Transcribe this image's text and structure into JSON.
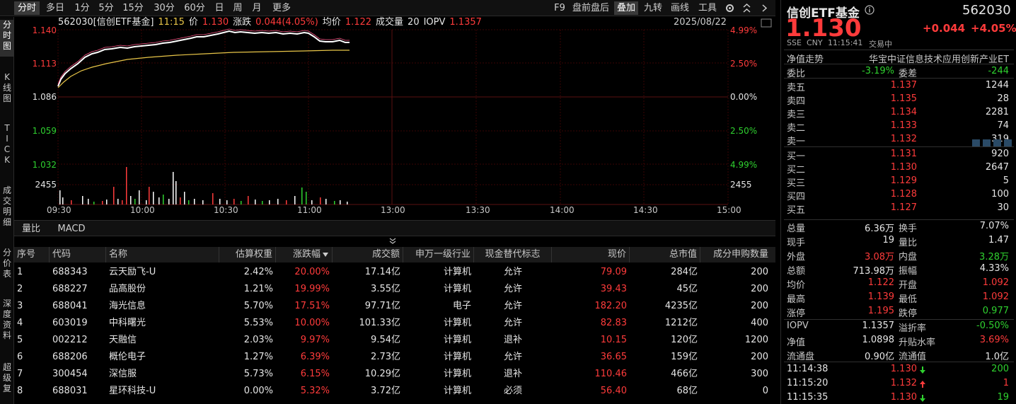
{
  "toolbar": {
    "periods": [
      "分时",
      "多日",
      "1分",
      "5分",
      "15分",
      "30分",
      "60分",
      "日",
      "周",
      "月",
      "更多"
    ],
    "tools": [
      "F9",
      "盘前盘后",
      "叠加",
      "九转",
      "画线",
      "工具"
    ]
  },
  "left_tabs": [
    "分\n时\n图",
    "K\n线\n图",
    "T\nI\nC\nK",
    "成\n交\n明\n细",
    "分\n价\n表",
    "深\n度\n资\n料",
    "超\n级\n复"
  ],
  "chart": {
    "code_name": "562030[信创ETF基金]",
    "time": "11:15",
    "price_label": "价",
    "price": "1.130",
    "change_label": "涨跌",
    "change": "0.044(4.05%)",
    "avg_label": "均价",
    "avg": "1.122",
    "vol_label": "成交量",
    "vol": "20",
    "iopv_label": "IOPV",
    "iopv": "1.1357",
    "date": "2025/08/22",
    "left_labels": [
      "1.140",
      "1.113",
      "1.086",
      "1.059",
      "1.032"
    ],
    "right_labels": [
      "4.99%",
      "2.50%",
      "0.00%",
      "2.50%",
      "4.99%"
    ],
    "vol_label_value": "2455",
    "time_labels": [
      "09:30",
      "10:00",
      "10:30",
      "11:00",
      "13:00",
      "13:30",
      "14:00",
      "14:30",
      "15:00"
    ]
  },
  "indicator_tabs": [
    "量比",
    "MACD"
  ],
  "table": {
    "headers": [
      "序号",
      "代码",
      "名称",
      "估算权重",
      "涨跌幅",
      "成交额",
      "申万一级行业",
      "现金替代标志",
      "现价",
      "总市值",
      "成分申购数量"
    ],
    "rows": [
      [
        "1",
        "688343",
        "云天励飞-U",
        "2.42%",
        "20.00%",
        "17.14亿",
        "计算机",
        "允许",
        "79.09",
        "284亿",
        "200"
      ],
      [
        "2",
        "688227",
        "品高股份",
        "1.21%",
        "19.99%",
        "3.55亿",
        "计算机",
        "允许",
        "39.43",
        "45亿",
        "200"
      ],
      [
        "3",
        "688041",
        "海光信息",
        "5.70%",
        "17.51%",
        "97.71亿",
        "电子",
        "允许",
        "182.20",
        "4235亿",
        "200"
      ],
      [
        "4",
        "603019",
        "中科曙光",
        "5.53%",
        "10.00%",
        "101.33亿",
        "计算机",
        "允许",
        "82.83",
        "1212亿",
        "400"
      ],
      [
        "5",
        "002212",
        "天融信",
        "2.03%",
        "9.97%",
        "9.54亿",
        "计算机",
        "退补",
        "10.15",
        "120亿",
        "1200"
      ],
      [
        "6",
        "688206",
        "概伦电子",
        "1.27%",
        "6.39%",
        "2.73亿",
        "计算机",
        "允许",
        "36.65",
        "159亿",
        "200"
      ],
      [
        "7",
        "300454",
        "深信服",
        "5.73%",
        "6.15%",
        "10.29亿",
        "计算机",
        "退补",
        "110.46",
        "466亿",
        "300"
      ],
      [
        "8",
        "688031",
        "星环科技-U",
        "0.00%",
        "5.32%",
        "3.72亿",
        "计算机",
        "必须",
        "56.40",
        "68亿",
        "0"
      ]
    ]
  },
  "quote": {
    "name": "信创ETF基金",
    "code": "562030",
    "price": "1.130",
    "change": "+0.044",
    "change_pct": "+4.05%",
    "exchange": "SSE",
    "currency": "CNY",
    "time": "11:15:41",
    "status": "交易中",
    "nav_trend": "净值走势",
    "tracked_index": "华宝中证信息技术应用创新产业ET",
    "weibi_label": "委比",
    "weibi": "-3.19%",
    "weicha_label": "委差",
    "weicha": "-244",
    "asks": [
      {
        "label": "卖五",
        "price": "1.137",
        "vol": "1244"
      },
      {
        "label": "卖四",
        "price": "1.135",
        "vol": "28"
      },
      {
        "label": "卖三",
        "price": "1.134",
        "vol": "2281"
      },
      {
        "label": "卖二",
        "price": "1.133",
        "vol": "74"
      },
      {
        "label": "卖一",
        "price": "1.132",
        "vol": "319"
      }
    ],
    "bids": [
      {
        "label": "买一",
        "price": "1.131",
        "vol": "920"
      },
      {
        "label": "买二",
        "price": "1.130",
        "vol": "2647"
      },
      {
        "label": "买三",
        "price": "1.129",
        "vol": "5"
      },
      {
        "label": "买四",
        "price": "1.128",
        "vol": "100"
      },
      {
        "label": "买五",
        "price": "1.127",
        "vol": "30"
      }
    ],
    "stats": [
      {
        "l1": "总量",
        "v1": "6.36万",
        "l2": "换手",
        "v2": "7.07%"
      },
      {
        "l1": "现手",
        "v1": "19",
        "l2": "量比",
        "v2": "1.47"
      },
      {
        "l1": "外盘",
        "v1": "3.08万",
        "l2": "内盘",
        "v2": "3.28万"
      },
      {
        "l1": "总额",
        "v1": "713.98万",
        "l2": "振幅",
        "v2": "4.33%"
      },
      {
        "l1": "均价",
        "v1": "1.122",
        "l2": "开盘",
        "v2": "1.092"
      },
      {
        "l1": "最高",
        "v1": "1.139",
        "l2": "最低",
        "v2": "1.092"
      },
      {
        "l1": "涨停",
        "v1": "1.195",
        "l2": "跌停",
        "v2": "0.977"
      }
    ],
    "stats2": [
      {
        "l1": "IOPV",
        "v1": "1.1357",
        "l2": "溢折率",
        "v2": "-0.50%"
      },
      {
        "l1": "净值",
        "v1": "1.0898",
        "l2": "升贴水率",
        "v2": "3.69%"
      },
      {
        "l1": "流通盘",
        "v1": "0.90亿",
        "l2": "流通值",
        "v2": "1.0亿"
      }
    ],
    "ticks": [
      {
        "time": "11:14:38",
        "price": "1.130",
        "dir": "down",
        "vol": "200"
      },
      {
        "time": "11:15:20",
        "price": "1.132",
        "dir": "up",
        "vol": "1"
      },
      {
        "time": "11:15:35",
        "price": "1.130",
        "dir": "down",
        "vol": "19"
      }
    ]
  },
  "colors": {
    "up": "#ff3b3b",
    "down": "#2fd12f",
    "price_line": "#ffffff",
    "avg_line": "#e8c548",
    "grid": "#3a0000"
  }
}
